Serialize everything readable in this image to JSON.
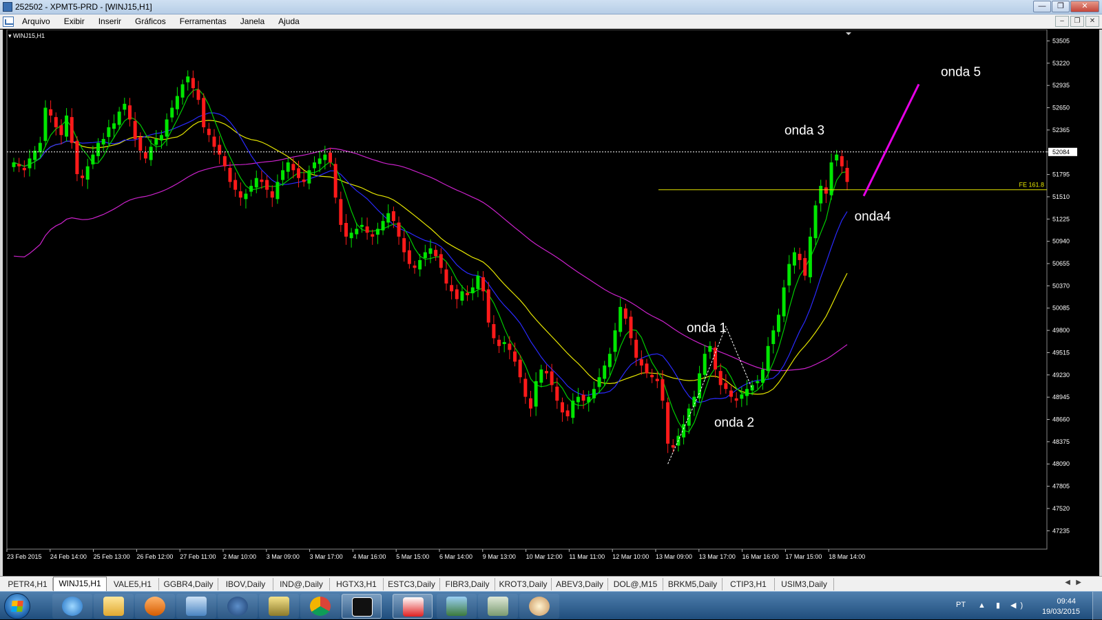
{
  "window": {
    "title": "252502 - XPMT5-PRD - [WINJ15,H1]",
    "buttons": {
      "minimize": "—",
      "restore": "❐",
      "close": "✕"
    }
  },
  "menu": {
    "items": [
      "Arquivo",
      "Exibir",
      "Inserir",
      "Gráficos",
      "Ferramentas",
      "Janela",
      "Ajuda"
    ],
    "mdi_buttons": [
      "–",
      "❐",
      "✕"
    ]
  },
  "chart": {
    "symbol_label": "WINJ15,H1",
    "current_price_label": "52084",
    "fib_label": "FE 161.8",
    "colors": {
      "background": "#000000",
      "bull": "#00e600",
      "bear": "#ff1a1a",
      "ma_fast": "#00cc00",
      "ma_mid": "#2a2aff",
      "ma_slow": "#e6e600",
      "ma_long": "#cc22cc",
      "fib_line": "#e6e600",
      "projection": "#e600e6",
      "axis_text": "#ffffff"
    }
  },
  "chart_data": {
    "type": "candlestick",
    "title": "WINJ15,H1",
    "price_ticks": [
      "53505",
      "53220",
      "52935",
      "52650",
      "52365",
      "52084",
      "51795",
      "51510",
      "51225",
      "50940",
      "50655",
      "50370",
      "50085",
      "49800",
      "49515",
      "49230",
      "48945",
      "48660",
      "48375",
      "48090",
      "47805",
      "47520",
      "47235"
    ],
    "ylim": [
      47000,
      53650
    ],
    "time_ticks": [
      "23 Feb 2015",
      "24 Feb 14:00",
      "25 Feb 13:00",
      "26 Feb 12:00",
      "27 Feb 11:00",
      "2 Mar 10:00",
      "3 Mar 09:00",
      "3 Mar 17:00",
      "4 Mar 16:00",
      "5 Mar 15:00",
      "6 Mar 14:00",
      "9 Mar 13:00",
      "10 Mar 12:00",
      "11 Mar 11:00",
      "12 Mar 10:00",
      "13 Mar 09:00",
      "13 Mar 17:00",
      "16 Mar 16:00",
      "17 Mar 15:00",
      "18 Mar 14:00"
    ],
    "current_price": 52084,
    "fib_level": {
      "label": "FE 161.8",
      "price": 51600
    },
    "annotations": [
      {
        "text": "onda 1",
        "price": 49830
      },
      {
        "text": "onda 2",
        "price": 48620
      },
      {
        "text": "onda 3",
        "price": 52360
      },
      {
        "text": "onda4",
        "price": 51260
      },
      {
        "text": "onda 5",
        "price": 53110
      }
    ],
    "candles_close": [
      51950,
      51900,
      51850,
      52000,
      52100,
      52200,
      52650,
      52550,
      52400,
      52300,
      52550,
      52200,
      51800,
      51750,
      51900,
      52050,
      52200,
      52250,
      52400,
      52450,
      52600,
      52700,
      52500,
      52250,
      52100,
      52000,
      52150,
      52250,
      52300,
      52500,
      52650,
      52800,
      52950,
      53050,
      52900,
      52750,
      52400,
      52300,
      52150,
      52050,
      51900,
      51700,
      51600,
      51500,
      51550,
      51650,
      51750,
      51700,
      51600,
      51500,
      51700,
      51850,
      51950,
      51850,
      51750,
      51700,
      51850,
      51950,
      52000,
      52050,
      51950,
      51500,
      51150,
      51000,
      51050,
      51100,
      51150,
      51050,
      51000,
      51100,
      51200,
      51300,
      51200,
      51000,
      50800,
      50650,
      50600,
      50700,
      50800,
      50850,
      50750,
      50600,
      50400,
      50300,
      50200,
      50300,
      50250,
      50350,
      50500,
      50300,
      49900,
      49700,
      49600,
      49650,
      49550,
      49400,
      49200,
      48950,
      48800,
      49150,
      49300,
      49250,
      49100,
      48900,
      48750,
      48700,
      48900,
      48950,
      48900,
      48950,
      49050,
      49200,
      49350,
      49500,
      49800,
      50100,
      49950,
      49700,
      49450,
      49350,
      49250,
      49200,
      49150,
      48900,
      48350,
      48300,
      48450,
      48600,
      48800,
      48950,
      49250,
      49500,
      49600,
      49300,
      49100,
      49050,
      48950,
      48900,
      48980,
      49050,
      49100,
      49150,
      49300,
      49600,
      49800,
      50000,
      50350,
      50650,
      50800,
      50700,
      50500,
      51000,
      51400,
      51650,
      51550,
      51950,
      52050,
      51900,
      51700
    ]
  },
  "tabs": [
    "PETR4,H1",
    "WINJ15,H1",
    "VALE5,H1",
    "GGBR4,Daily",
    "IBOV,Daily",
    "IND@,Daily",
    "HGTX3,H1",
    "ESTC3,Daily",
    "FIBR3,Daily",
    "KROT3,Daily",
    "ABEV3,Daily",
    "DOL@,M15",
    "BRKM5,Daily",
    "CTIP3,H1",
    "USIM3,Daily"
  ],
  "tab_nav": {
    "prev": "◀",
    "next": "▶"
  },
  "taskbar": {
    "tray": {
      "lang": "PT",
      "icons": "▲ ▮ ◀)"
    },
    "clock": {
      "time": "09:44",
      "date": "19/03/2015"
    }
  }
}
